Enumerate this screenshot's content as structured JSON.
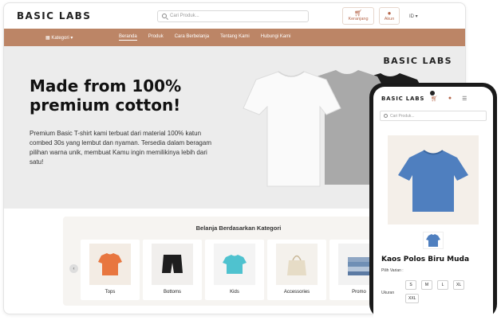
{
  "desktop": {
    "brand": "BASIC LABS",
    "search_placeholder": "Cari Produk...",
    "cart_label": "Keranjang",
    "account_label": "Akun",
    "language": "ID ▾",
    "nav": {
      "category_label": "▦ Kategori ▾",
      "links": [
        "Beranda",
        "Produk",
        "Cara Berbelanja",
        "Tentang Kami",
        "Hubungi Kami"
      ]
    },
    "hero": {
      "brand": "BASIC LABS",
      "headline": "Made from 100% premium cotton!",
      "body": "Premium Basic T-shirt kami terbuat dari material 100% katun combed 30s yang lembut dan nyaman. Tersedia dalam beragam pilihan warna unik, membuat Kamu ingin memilikinya lebih dari satu!"
    },
    "categories": {
      "title": "Belanja Berdasarkan Kategori",
      "items": [
        "Tops",
        "Bottoms",
        "Kids",
        "Accessories",
        "Promo"
      ]
    }
  },
  "mobile": {
    "brand": "BASIC LABS",
    "search_placeholder": "Cari Produk...",
    "product_name": "Kaos Polos Biru Muda",
    "variant_label": "Pilih Varian :",
    "size_label": "Ukuran",
    "sizes": [
      "S",
      "M",
      "L",
      "XL",
      "XXL"
    ]
  },
  "colors": {
    "accent": "#bc8566",
    "hero_bg": "#ececec",
    "product_blue": "#4f7fbf"
  }
}
